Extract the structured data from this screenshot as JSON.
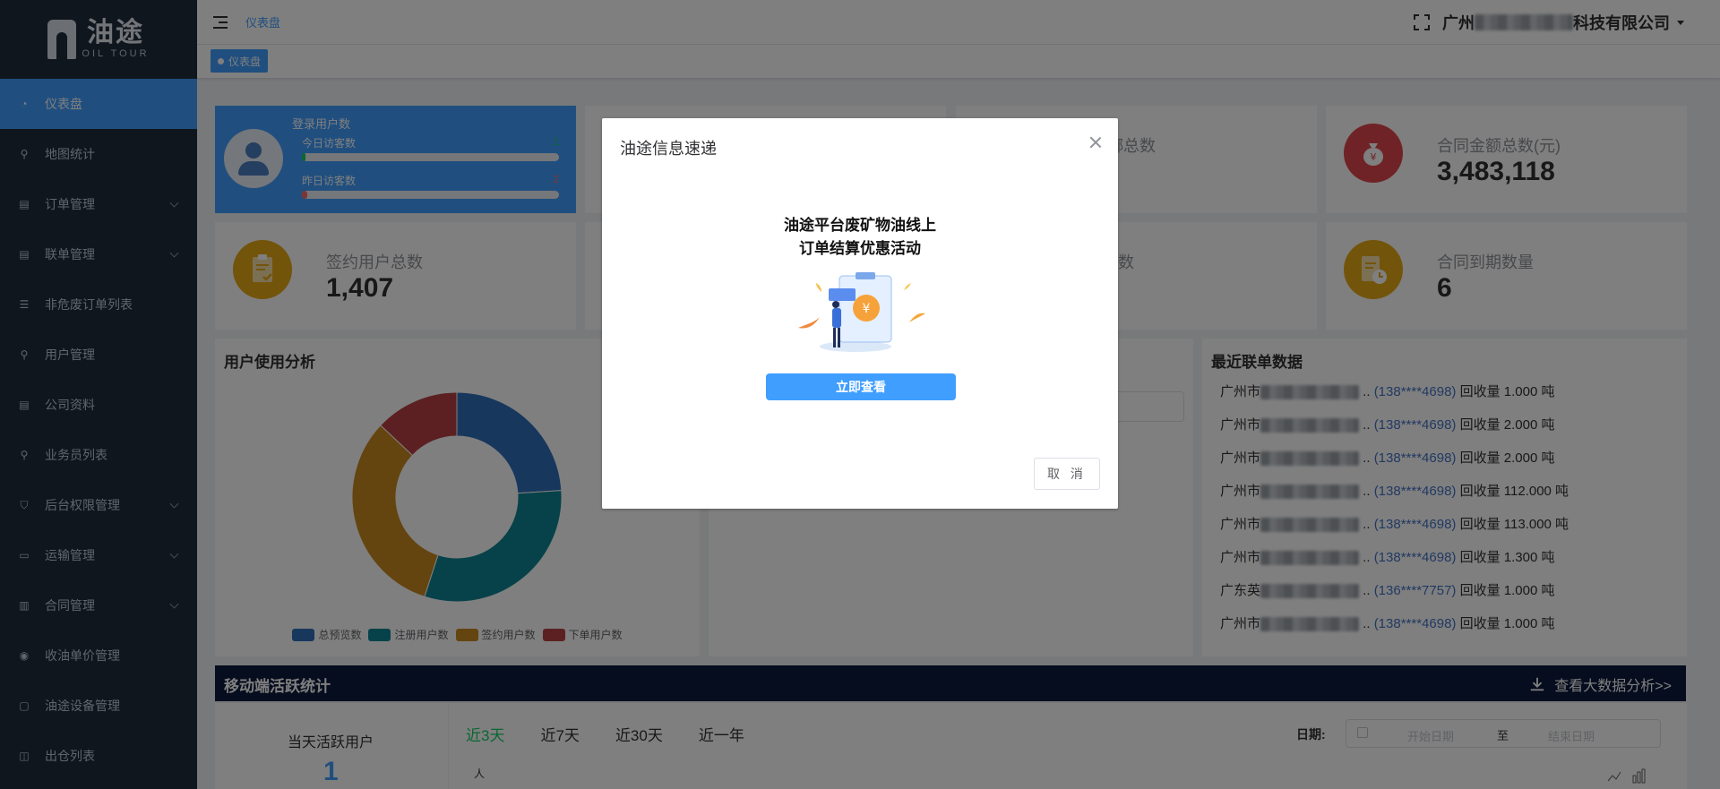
{
  "logo": {
    "cn": "油途",
    "en": "OIL TOUR"
  },
  "sidebar": {
    "items": [
      {
        "label": "仪表盘",
        "icon": "dashboard-icon"
      },
      {
        "label": "地图统计",
        "icon": "map-icon"
      },
      {
        "label": "订单管理",
        "icon": "order-icon"
      },
      {
        "label": "联单管理",
        "icon": "manifest-icon"
      },
      {
        "label": "非危废订单列表",
        "icon": "list-icon"
      },
      {
        "label": "用户管理",
        "icon": "user-icon"
      },
      {
        "label": "公司资料",
        "icon": "document-icon"
      },
      {
        "label": "业务员列表",
        "icon": "salesperson-icon"
      },
      {
        "label": "后台权限管理",
        "icon": "shield-icon"
      },
      {
        "label": "运输管理",
        "icon": "truck-icon"
      },
      {
        "label": "合同管理",
        "icon": "contract-icon"
      },
      {
        "label": "收油单价管理",
        "icon": "price-icon"
      },
      {
        "label": "油途设备管理",
        "icon": "device-icon"
      },
      {
        "label": "出仓列表",
        "icon": "warehouse-icon"
      }
    ]
  },
  "header": {
    "breadcrumb": "仪表盘",
    "company_prefix": "广州",
    "company_suffix": "科技有限公司"
  },
  "tags": {
    "active": "仪表盘"
  },
  "user_card": {
    "title": "登录用户数",
    "today_label": "今日访客数",
    "today_value": "1",
    "yesterday_label": "昨日访客数",
    "yesterday_value": "2"
  },
  "stats": {
    "partial_label": "绑总数",
    "contract_amount_label": "合同金额总数(元)",
    "contract_amount_value": "3,483,118",
    "signed_users_label": "签约用户总数",
    "signed_users_value": "1,407",
    "partial_label2": "数",
    "expiring_label": "合同到期数量",
    "expiring_value": "6"
  },
  "usage": {
    "title": "用户使用分析",
    "legend": [
      "总预览数",
      "注册用户数",
      "签约用户数",
      "下单用户数"
    ]
  },
  "chart_data": {
    "type": "pie",
    "donut": true,
    "categories": [
      "总预览数",
      "注册用户数",
      "签约用户数",
      "下单用户数"
    ],
    "values": [
      24,
      31,
      32,
      13
    ],
    "colors": [
      "#2f6fba",
      "#0e8595",
      "#c9881f",
      "#b94145"
    ]
  },
  "recent": {
    "title": "最近联单数据",
    "rows": [
      {
        "city": "广州市",
        "phone": "(138****4698)",
        "text": "回收量 1.000 吨"
      },
      {
        "city": "广州市",
        "phone": "(138****4698)",
        "text": "回收量 2.000 吨"
      },
      {
        "city": "广州市",
        "phone": "(138****4698)",
        "text": "回收量 2.000 吨"
      },
      {
        "city": "广州市",
        "phone": "(138****4698)",
        "text": "回收量 112.000 吨"
      },
      {
        "city": "广州市",
        "phone": "(138****4698)",
        "text": "回收量 113.000 吨"
      },
      {
        "city": "广州市",
        "phone": "(138****4698)",
        "text": "回收量 1.300 吨"
      },
      {
        "city": "广东英",
        "phone": "(136****7757)",
        "text": "回收量 1.000 吨"
      },
      {
        "city": "广州市",
        "phone": "(138****4698)",
        "text": "回收量 1.000 吨"
      }
    ]
  },
  "mobile": {
    "title": "移动端活跃统计",
    "bigdata_link": "查看大数据分析>>",
    "active_label": "当天活跃用户",
    "active_value": "1",
    "ranges": [
      "近3天",
      "近7天",
      "近30天",
      "近一年"
    ],
    "date_label": "日期:",
    "start_placeholder": "开始日期",
    "to": "至",
    "end_placeholder": "结束日期",
    "y_unit": "人"
  },
  "dialog": {
    "title": "油途信息速递",
    "promo_line1": "油途平台废矿物油线上",
    "promo_line2": "订单结算优惠活动",
    "view_button": "立即查看",
    "cancel_button": "取 消"
  },
  "colors": {
    "sidebar_bg": "#1f2d3d",
    "accent": "#409eff",
    "green": "#13ce66",
    "red_icon": "#e0474c",
    "gold_icon": "#e6a817",
    "mobile_bar": "#0c1a3c"
  }
}
